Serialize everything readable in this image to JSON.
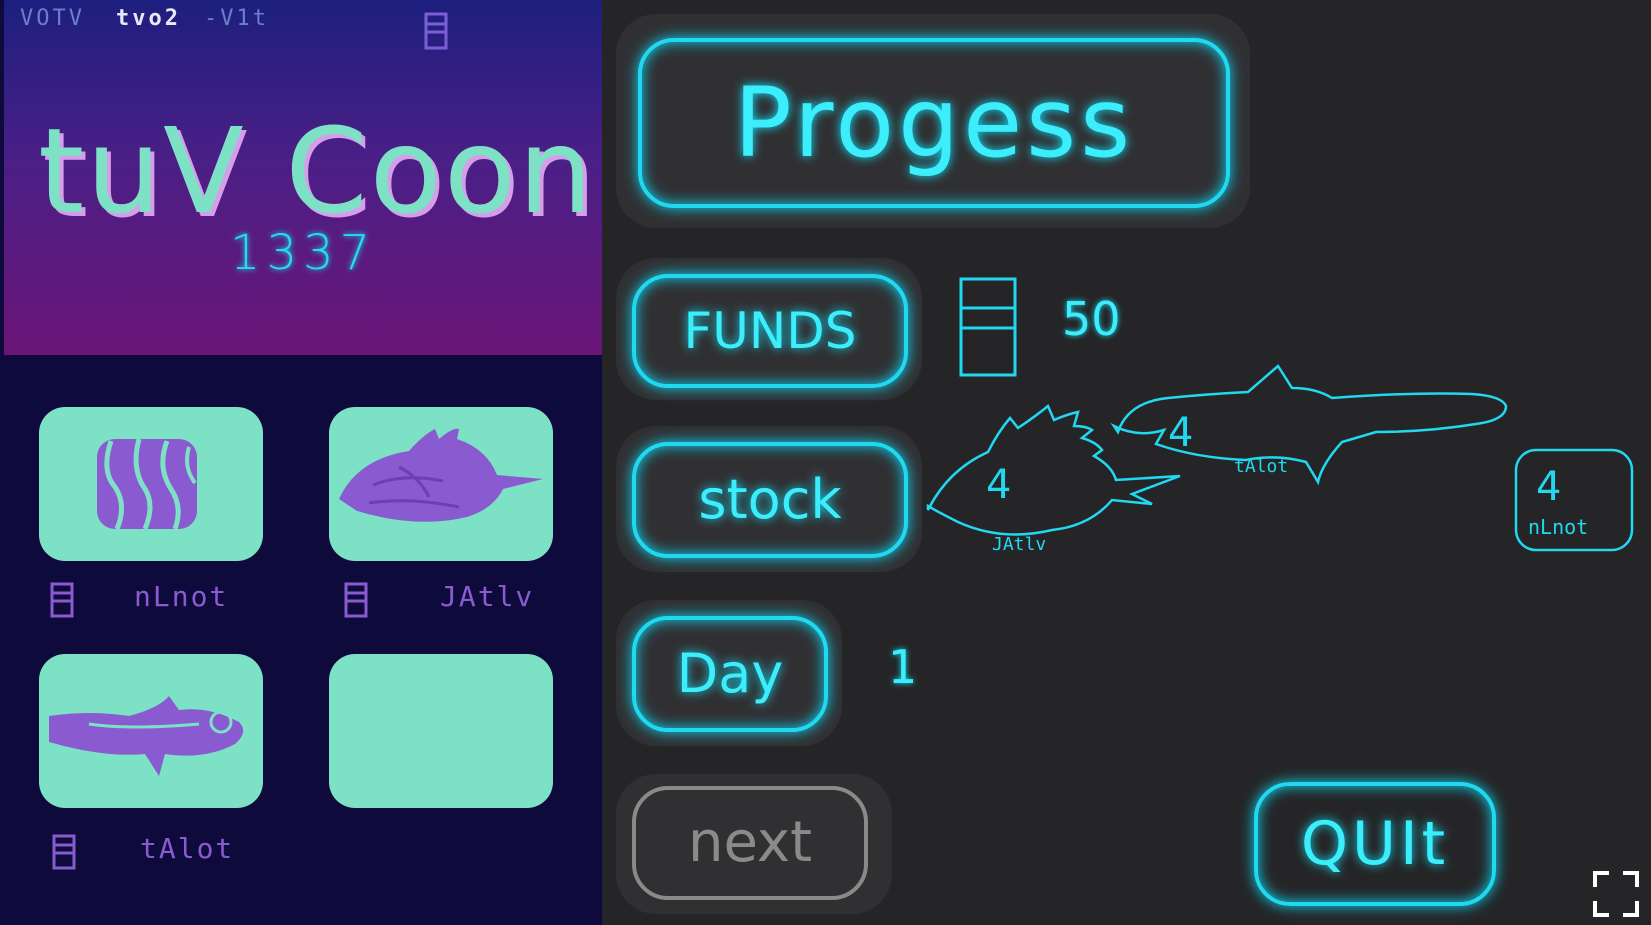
{
  "header": {
    "label_a": "VOTV",
    "label_b": "tvo2",
    "label_c": "-V1t",
    "title": "tuV Coon",
    "year": "1337"
  },
  "shop": {
    "slots": [
      {
        "item": "striped-cube",
        "price_label": "nLnot"
      },
      {
        "item": "spiky-fish",
        "price_label": "JAtlv"
      },
      {
        "item": "long-fish",
        "price_label": "tAlot"
      },
      {
        "item": "empty",
        "price_label": ""
      }
    ]
  },
  "panel": {
    "progress_label": "Progess",
    "funds_label": "FUNDS",
    "funds_value": "50",
    "stock_label": "stock",
    "day_label": "Day",
    "day_value": "1",
    "next_label": "next",
    "quit_label": "QUIt"
  },
  "stock_items": [
    {
      "count": "4",
      "name": "JAtlv",
      "kind": "spiky-fish"
    },
    {
      "count": "4",
      "name": "tAlot",
      "kind": "long-fish"
    },
    {
      "count": "4",
      "name": "nLnot",
      "kind": "striped-cube"
    }
  ],
  "colors": {
    "neon": "#20d8f0",
    "mint": "#7de1c5",
    "purple": "#8a5bd0",
    "dark": "#252527"
  }
}
